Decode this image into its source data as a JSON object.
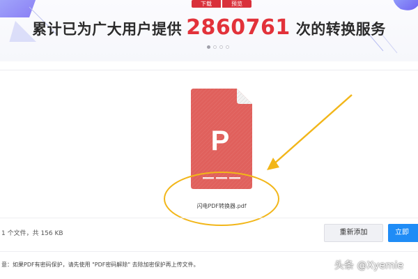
{
  "banner": {
    "prefix": "累计已为广大用户提供",
    "count": "2860761",
    "suffix": "次的转换服务",
    "carousel_dots": 4,
    "active_dot": 0
  },
  "file": {
    "icon_letter": "P",
    "download_label": "下载",
    "preview_label": "预览",
    "name": "闪电PDF转换器.pdf"
  },
  "summary": {
    "text": "1 个文件，共 156 KB"
  },
  "buttons": {
    "readd_label": "重新添加",
    "start_label": "立即"
  },
  "notice": {
    "text": "意：如果PDF有密码保护，请先使用 \"PDF密码解除\" 去除加密保护再上传文件。"
  },
  "watermark": {
    "text": "头条 @Xyemie"
  },
  "colors": {
    "accent_red": "#e2323a",
    "file_red": "#e0605c",
    "action_red": "#d9303a",
    "primary_blue": "#1f8cf6",
    "annotation_yellow": "#f2b619",
    "banner_purple": "#8e7ef0"
  }
}
